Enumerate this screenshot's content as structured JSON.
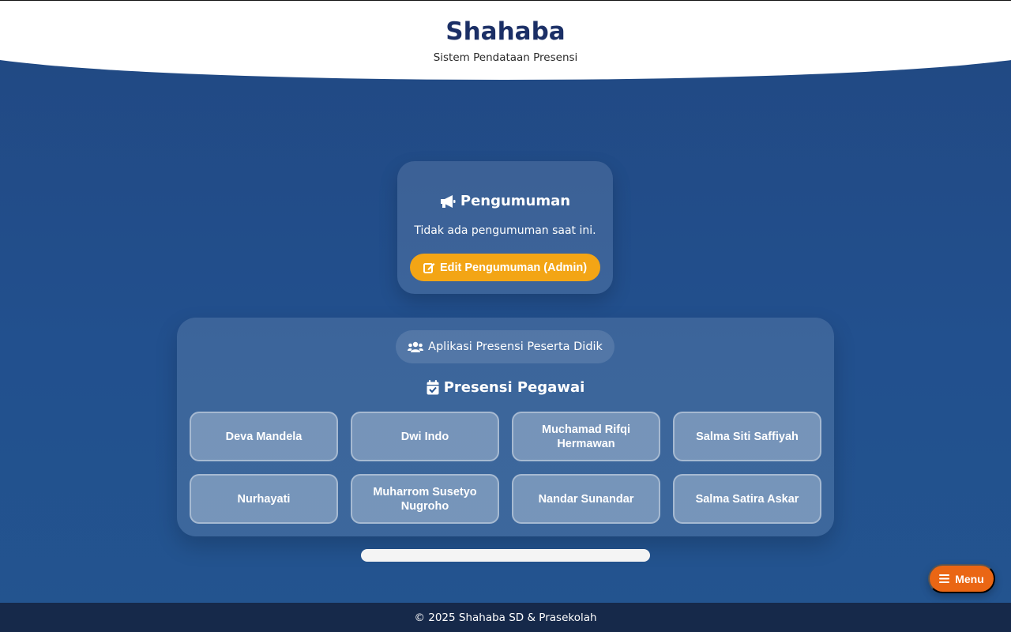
{
  "header": {
    "brand": "Shahaba",
    "tagline": "Sistem Pendataan Presensi"
  },
  "announcement": {
    "icon": "megaphone-icon",
    "title": "Pengumuman",
    "text": "Tidak ada pengumuman saat ini.",
    "edit_icon": "edit-icon",
    "edit_label": "Edit Pengumuman (Admin)"
  },
  "student_app": {
    "icon": "users-icon",
    "label": "Aplikasi Presensi Peserta Didik"
  },
  "staff": {
    "icon": "calendar-check-icon",
    "title": "Presensi Pegawai",
    "items": [
      {
        "name": "Deva Mandela"
      },
      {
        "name": "Dwi Indo"
      },
      {
        "name": "Muchamad Rifqi Hermawan"
      },
      {
        "name": "Salma Siti Saffiyah"
      },
      {
        "name": "Nurhayati"
      },
      {
        "name": "Muharrom Susetyo Nugroho"
      },
      {
        "name": "Nandar Sunandar"
      },
      {
        "name": "Salma Satira Askar"
      }
    ]
  },
  "menu": {
    "icon": "hamburger-icon",
    "label": "Menu"
  },
  "footer": {
    "text": "© 2025 Shahaba SD & Prasekolah"
  },
  "colors": {
    "background": "#22508e",
    "brand": "#1b2f66",
    "edit_button": "#f3a515",
    "menu_button": "#ea6614",
    "footer": "#16294a"
  }
}
